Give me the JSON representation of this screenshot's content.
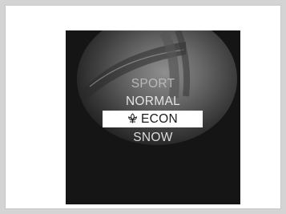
{
  "drive_mode_menu": {
    "items": [
      {
        "label": "SPORT",
        "selected": false
      },
      {
        "label": "NORMAL",
        "selected": false
      },
      {
        "label": "ECON",
        "selected": true,
        "icon": "econ-leaf-icon"
      },
      {
        "label": "SNOW",
        "selected": false
      }
    ]
  },
  "colors": {
    "page_background": "#d4d4d4",
    "screen_background": "#151515",
    "highlight_background": "#ffffff",
    "highlight_text": "#1a1a1a"
  }
}
